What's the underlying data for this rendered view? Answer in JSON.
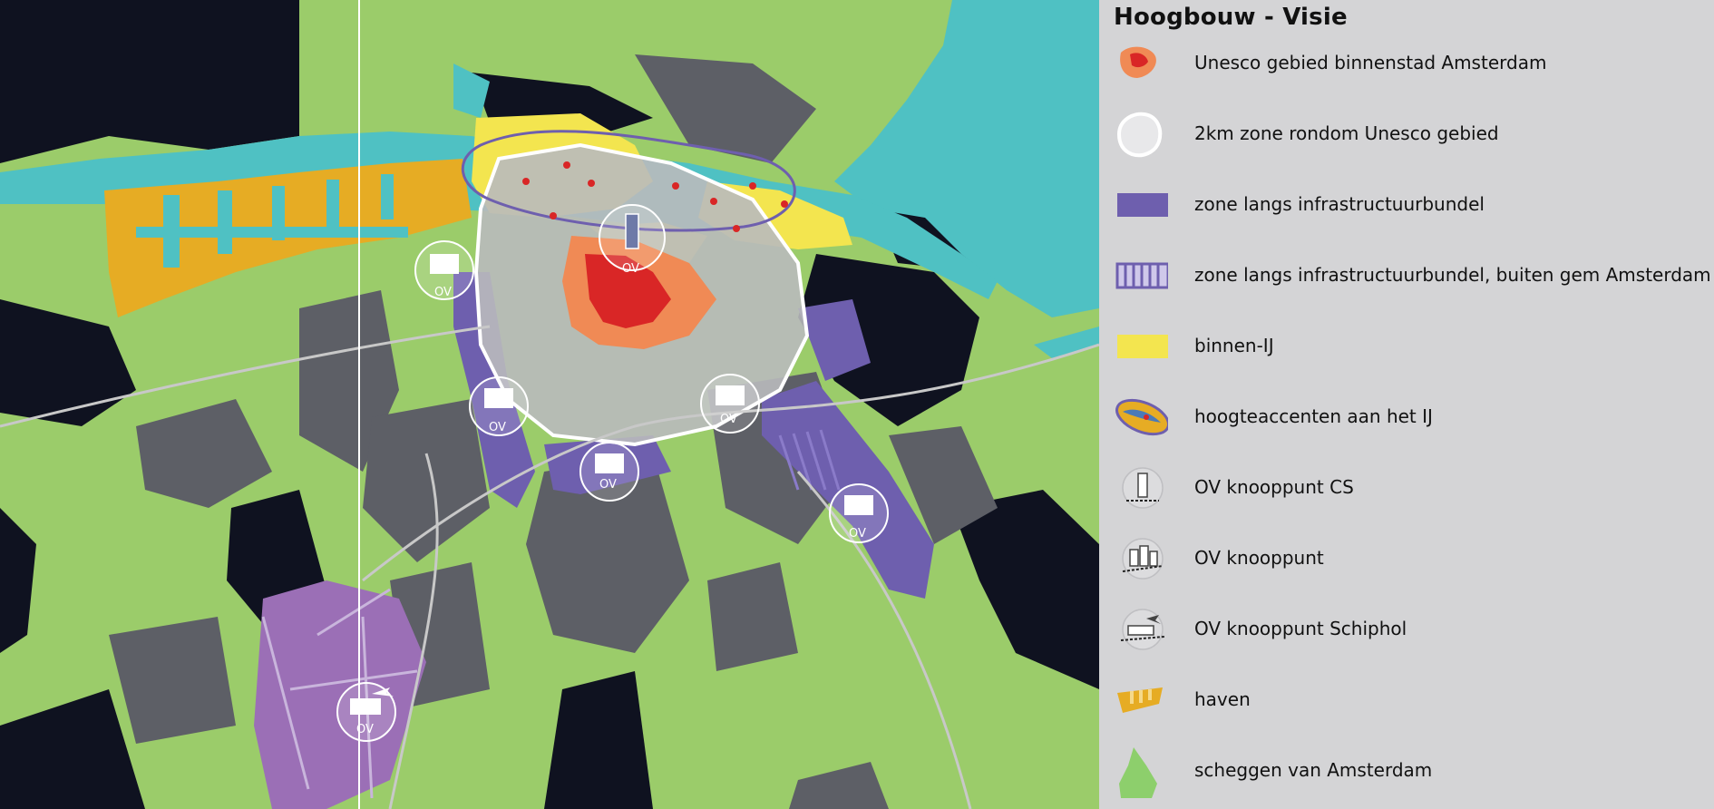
{
  "legend": {
    "title": "Hoogbouw - Visie",
    "items": [
      {
        "label": "Unesco gebied binnenstad Amsterdam",
        "icon": "unesco-area-icon"
      },
      {
        "label": "2km zone rondom Unesco gebied",
        "icon": "buffer-zone-icon"
      },
      {
        "label": "zone langs infrastructuurbundel",
        "icon": "infrastructure-zone-icon"
      },
      {
        "label": "zone langs infrastructuurbundel, buiten  gem Amsterdam",
        "icon": "infrastructure-zone-outside-icon"
      },
      {
        "label": "binnen-IJ",
        "icon": "binnen-ij-icon"
      },
      {
        "label": "hoogteaccenten aan het IJ",
        "icon": "height-accents-icon"
      },
      {
        "label": "OV knooppunt CS",
        "icon": "ov-hub-cs-icon"
      },
      {
        "label": "OV knooppunt",
        "icon": "ov-hub-icon"
      },
      {
        "label": "OV knooppunt Schiphol",
        "icon": "ov-hub-schiphol-icon"
      },
      {
        "label": "haven",
        "icon": "harbour-icon"
      },
      {
        "label": "scheggen van Amsterdam",
        "icon": "green-wedge-icon"
      }
    ]
  },
  "map": {
    "ov_label": "OV"
  },
  "colors": {
    "water": "#4fc1c3",
    "green": "#9bcc6a",
    "dark_built": "#0f1220",
    "grey_built": "#5d5f66",
    "harbour": "#e6ac24",
    "binnen_ij": "#f3e54f",
    "infrastructure_zone": "#6e5fae",
    "unesco": "#f08a55",
    "unesco_core": "#d92626",
    "buffer_zone": "#b9babd",
    "schiphol": "#9b6fb6"
  }
}
